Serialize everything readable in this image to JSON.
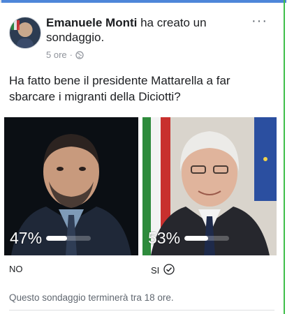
{
  "post": {
    "author_name": "Emanuele Monti",
    "action_text": " ha creato un sondaggio.",
    "time": "5 ore",
    "separator": "·",
    "privacy_icon": "globe-icon",
    "more_icon": "more-options-icon"
  },
  "poll": {
    "question": "Ha fatto bene il presidente Mattarella a far sbarcare i migranti della Diciotti?",
    "options": [
      {
        "label": "NO",
        "percent_text": "47%",
        "percent": 47,
        "selected": false
      },
      {
        "label": "SI",
        "percent_text": "53%",
        "percent": 53,
        "selected": true
      }
    ],
    "footer": "Questo sondaggio terminerà tra 18 ore."
  },
  "colors": {
    "top_rule": "#4e86d9",
    "frame_right": "#3fbf4a",
    "text_primary": "#1c1e21",
    "text_secondary": "#90949c"
  }
}
